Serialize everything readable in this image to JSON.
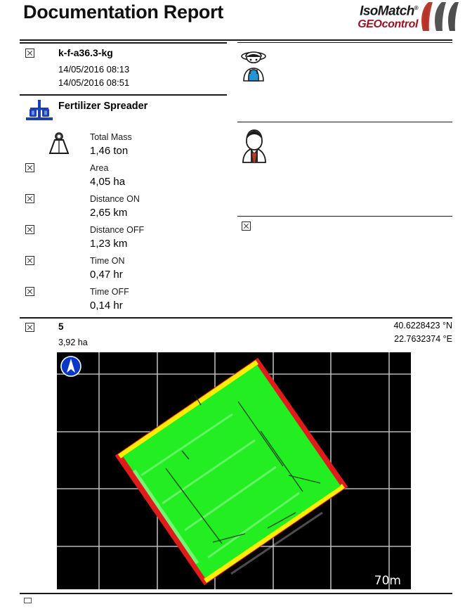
{
  "header": {
    "title": "Documentation Report",
    "logo": {
      "brand": "IsoMatch",
      "trademark": "®",
      "product": "GEOcontrol",
      "brand_color": "#1a1a1a",
      "product_color": "#9c1126",
      "blade_colors": [
        "#c0392b",
        "#555555",
        "#4d4d4d"
      ]
    }
  },
  "task": {
    "name": "k-f-a36.3-kg",
    "start_time": "14/05/2016 08:13",
    "end_time": "14/05/2016 08:51",
    "operator_icon": "farmer-icon",
    "customer_icon": "business-person-icon"
  },
  "implement": {
    "name": "Fertilizer Spreader",
    "icon": "fertilizer-spreader-icon",
    "icon_color": "#1a3fb0"
  },
  "metrics": [
    {
      "label": "Total Mass",
      "value": "1,46 ton",
      "icon": "weight-icon"
    },
    {
      "label": "Area",
      "value": "4,05 ha",
      "icon": "image-placeholder-icon"
    },
    {
      "label": "Distance ON",
      "value": "2,65 km",
      "icon": "image-placeholder-icon"
    },
    {
      "label": "Distance OFF",
      "value": "1,23 km",
      "icon": "image-placeholder-icon"
    },
    {
      "label": "Time ON",
      "value": "0,47 hr",
      "icon": "image-placeholder-icon"
    },
    {
      "label": "Time OFF",
      "value": "0,14 hr",
      "icon": "image-placeholder-icon"
    }
  ],
  "field": {
    "name": "5",
    "area": "3,92 ha",
    "latitude": "40.6228423 °N",
    "longitude": "22.7632374 °E",
    "map": {
      "scale_label": "70m",
      "north_arrow_icon": "north-arrow-icon",
      "background_color": "#000000",
      "grid_color": "#c8c8c8",
      "coverage_color": "#22ee22",
      "boundary_colors": {
        "yellow": "#ffee00",
        "red": "#e01b1b"
      }
    }
  }
}
